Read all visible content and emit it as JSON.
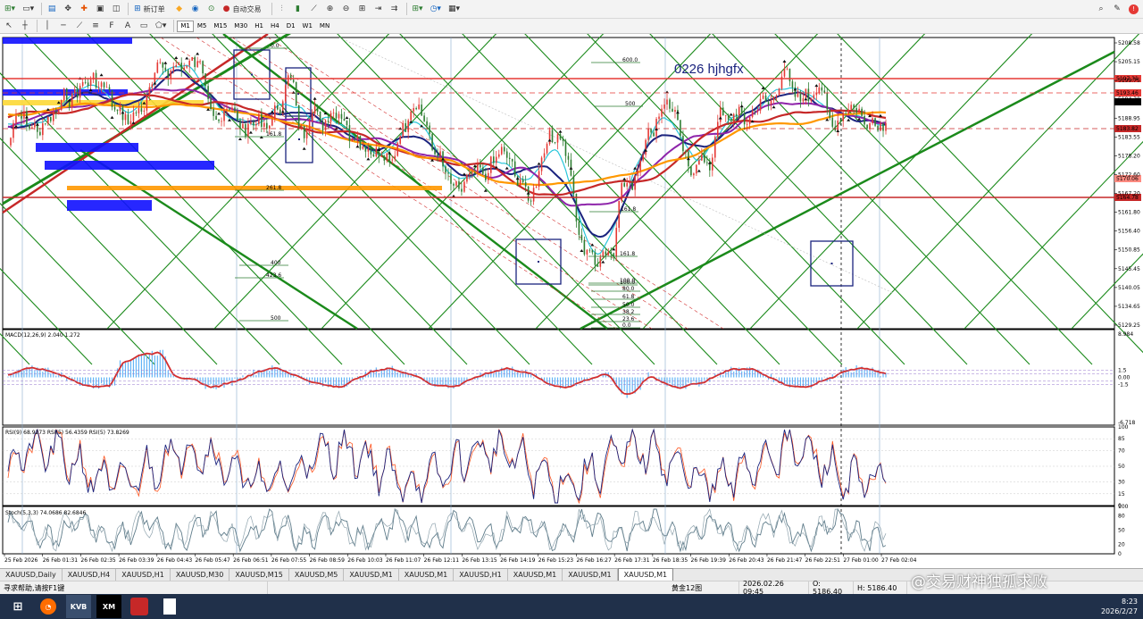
{
  "toolbar": {
    "new_order": "新订单",
    "auto_trading": "自动交易",
    "timeframes": [
      "M1",
      "M5",
      "M15",
      "M30",
      "H1",
      "H4",
      "D1",
      "W1",
      "MN"
    ]
  },
  "chart": {
    "annotation": "0226  hjhgfx",
    "price_ticks": [
      "5208.58",
      "5205.15",
      "5199.75",
      "5194.30",
      "5188.95",
      "5183.55",
      "5178.20",
      "5172.60",
      "5167.20",
      "5161.80",
      "5156.40",
      "5150.85",
      "5145.45",
      "5140.05",
      "5134.65",
      "5129.25"
    ],
    "price_highlights": [
      {
        "label": "5197.31",
        "color": "#e53935"
      },
      {
        "label": "5193.46",
        "color": "#e53935"
      },
      {
        "label": "5191.20",
        "color": "#000000"
      },
      {
        "label": "5183.82",
        "color": "#c62828"
      },
      {
        "label": "5164.78",
        "color": "#c62828"
      },
      {
        "label": "5170.06",
        "color": "#ff8a80"
      }
    ],
    "fib_labels": [
      "0.0",
      "600.0",
      "500",
      "400",
      "423.6",
      "500",
      "161.8",
      "261.8",
      "161.8",
      "100.0",
      "80.0",
      "61.8",
      "50.0",
      "38.2",
      "23.6",
      "0.0",
      "161.8",
      "100.0"
    ],
    "macd_label": "MACD(12,26,9) 2.040 1.272",
    "macd_ticks": [
      "8.984",
      "1.5",
      "0.00",
      "-1.5",
      "-6.718"
    ],
    "rsi_label": "RSI(9) 68.9273   RSI(5) 56.4359   RSI(5) 73.8269",
    "rsi_ticks": [
      "100",
      "85",
      "70",
      "50",
      "30",
      "15",
      "0"
    ],
    "stoch_label": "Stoch(5,3,3) 74.0686 82.6846",
    "stoch_ticks": [
      "100",
      "80",
      "50",
      "20",
      "0"
    ],
    "time_ticks": [
      "25 Feb 2026",
      "26 Feb 01:31",
      "26 Feb 02:35",
      "26 Feb 03:39",
      "26 Feb 04:43",
      "26 Feb 05:47",
      "26 Feb 06:51",
      "26 Feb 07:55",
      "26 Feb 08:59",
      "26 Feb 10:03",
      "26 Feb 11:07",
      "26 Feb 12:11",
      "26 Feb 13:15",
      "26 Feb 14:19",
      "26 Feb 15:23",
      "26 Feb 16:27",
      "26 Feb 17:31",
      "26 Feb 18:35",
      "26 Feb 19:39",
      "26 Feb 20:43",
      "26 Feb 21:47",
      "26 Feb 22:51",
      "27 Feb 01:00",
      "27 Feb 02:04"
    ]
  },
  "tabs": [
    "XAUUSD,Daily",
    "XAUUSD,H4",
    "XAUUSD,H1",
    "XAUUSD,M30",
    "XAUUSD,M15",
    "XAUUSD,M5",
    "XAUUSD,M1",
    "XAUUSD,M1",
    "XAUUSD,H1",
    "XAUUSD,M1",
    "XAUUSD,M1",
    "XAUUSD,M1"
  ],
  "active_tab_index": 11,
  "status": {
    "help": "寻求帮助,请按F1键",
    "profile": "黄金12图",
    "datetime": "2026.02.26 09:45",
    "open": "O: 5186.40",
    "high": "H: 5186.40"
  },
  "watermark": "@交易财神独孤求败",
  "taskbar": {
    "time": "8:23",
    "date": "2026/2/27",
    "apps": [
      "KVB",
      "XM"
    ]
  },
  "colors": {
    "up_candle": "#e53935",
    "down_candle": "#2e7d32",
    "channel": "#1b8a1b",
    "ma_blue": "#1a237e",
    "ma_purple": "#8e24aa",
    "ma_orange": "#ff9800",
    "ma_cyan": "#26c6da",
    "macd_hist": "#64b5f6",
    "macd_line": "#d32f2f",
    "rsi_a": "#1a237e",
    "rsi_b": "#ff5722",
    "stoch": "#607d8b"
  }
}
